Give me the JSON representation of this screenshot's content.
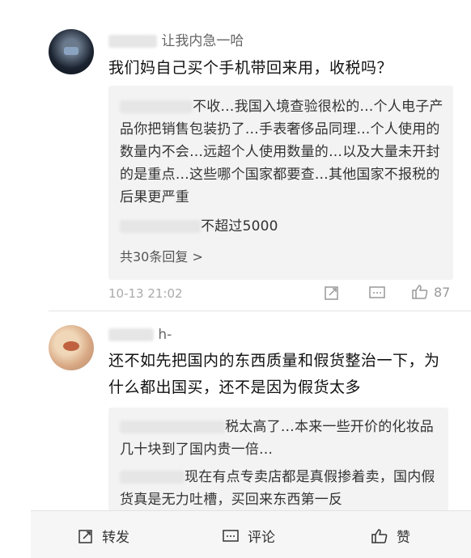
{
  "comments": [
    {
      "username": "让我内急一哈",
      "text": "我们妈自己买个手机带回来用，收税吗？",
      "replies": [
        {
          "user": "□□：",
          "text": "不收…我国入境查验很松的…个人电子产品你把销售包装扔了…手表奢侈品同理…个人使用的数量内不会…远超个人使用数量的…以及大量未开封的是重点…这些哪个国家都要查…其他国家不报税的后果更严重"
        },
        {
          "user": "□□□趐：",
          "text": "不超过5000"
        }
      ],
      "more_replies": "共30条回复 >",
      "timestamp": "10-13 21:02",
      "likes": "87"
    },
    {
      "username": "h-",
      "text": "还不如先把国内的东西质量和假货整治一下，为什么都出国买，还不是因为假货太多",
      "replies": [
        {
          "user": "□□：",
          "text": "税太高了…本来一些开价的化妆品几十块到了国内贵一倍…"
        },
        {
          "user": "□□：",
          "text": "现在有点专卖店都是真假掺着卖，国内假货真是无力吐槽，买回来东西第一反"
        }
      ]
    }
  ],
  "toolbar": {
    "repost": "转发",
    "comment": "评论",
    "like": "赞"
  }
}
